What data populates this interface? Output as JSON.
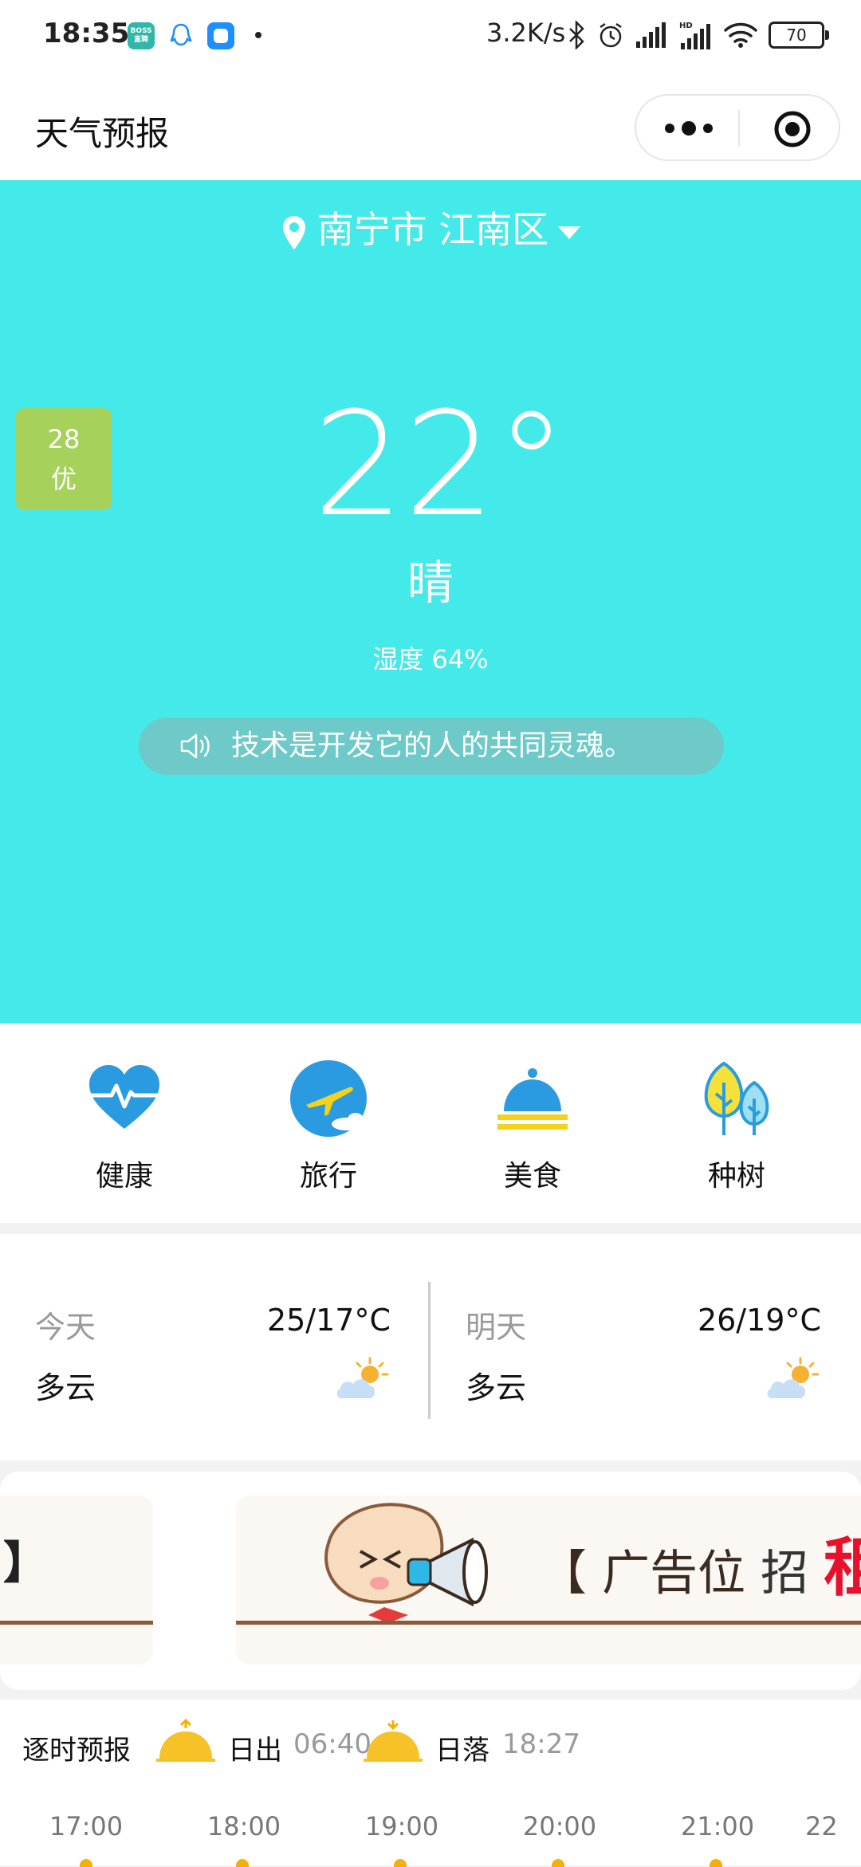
{
  "status_bar": {
    "time": "18:35",
    "boss_badge": "BOSS\n直聘",
    "network_speed": "3.2K/s",
    "battery": "70",
    "icons": [
      "boss-app-icon",
      "qq-icon",
      "message-app-icon",
      "bluetooth-icon",
      "alarm-icon",
      "signal-icon",
      "hd-signal-icon",
      "wifi-icon",
      "battery-icon"
    ]
  },
  "nav": {
    "title": "天气预报",
    "more_icon": "more-dots-icon",
    "close_icon": "target-circle-icon"
  },
  "hero": {
    "background": "#44e9e9",
    "location": "南宁市 江南区",
    "aqi_value": "28",
    "aqi_level": "优",
    "aqi_color": "#a6d25c",
    "temperature": "22°",
    "condition": "晴",
    "humidity": "湿度 64%",
    "notice": "技术是开发它的人的共同灵魂。"
  },
  "categories": [
    {
      "label": "健康",
      "icon": "heart-pulse-icon"
    },
    {
      "label": "旅行",
      "icon": "airplane-icon"
    },
    {
      "label": "美食",
      "icon": "food-cloche-icon"
    },
    {
      "label": "种树",
      "icon": "trees-icon"
    }
  ],
  "daily": [
    {
      "name": "今天",
      "range": "25/17°C",
      "condition": "多云",
      "icon": "partly-cloudy-icon"
    },
    {
      "name": "明天",
      "range": "26/19°C",
      "condition": "多云",
      "icon": "partly-cloudy-icon"
    }
  ],
  "ad": {
    "text": "广告位",
    "zhao": "招",
    "zu": "租",
    "bracket_left": "【",
    "bracket_right": "】"
  },
  "hourly": {
    "title": "逐时预报",
    "sunrise_label": "日出",
    "sunrise_time": "06:40",
    "sunset_label": "日落",
    "sunset_time": "18:27",
    "hours": [
      "17:00",
      "18:00",
      "19:00",
      "20:00",
      "21:00",
      "22"
    ]
  }
}
